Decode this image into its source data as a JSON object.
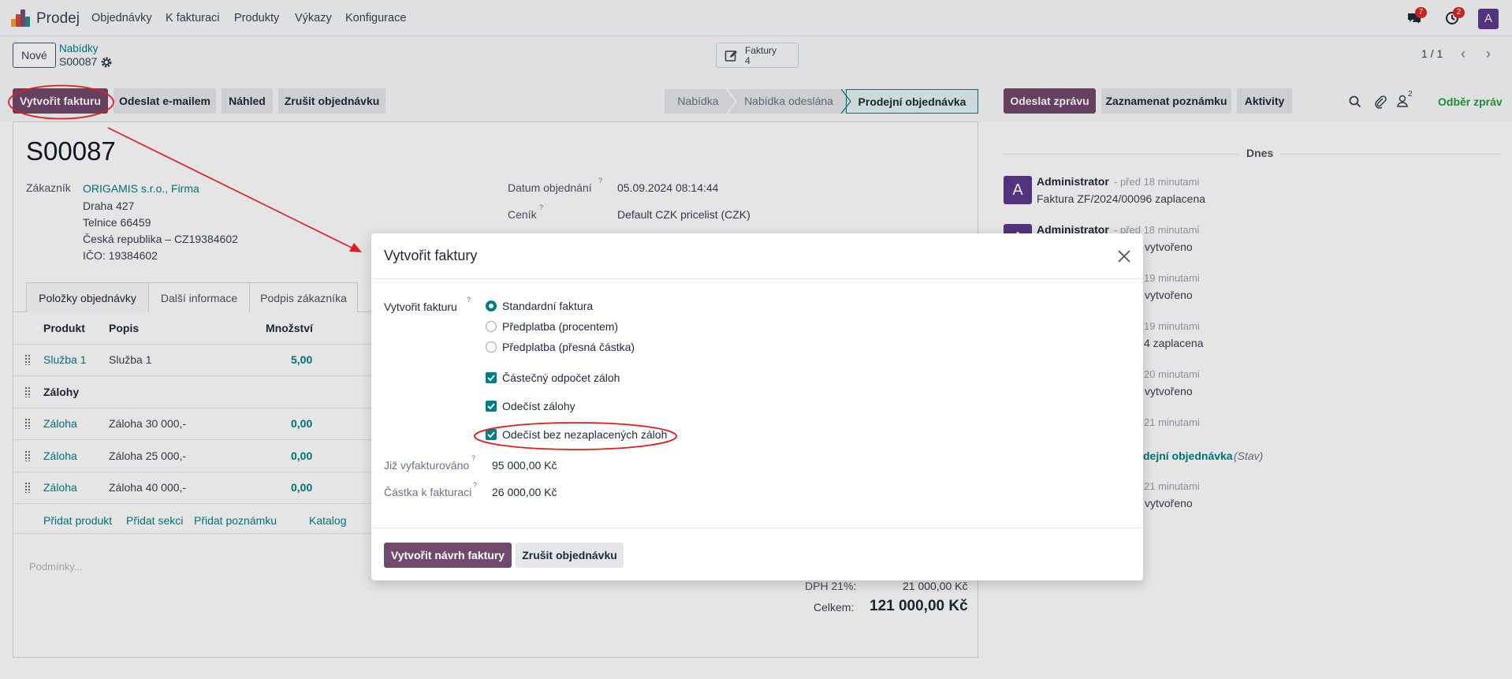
{
  "app": {
    "name": "Prodej",
    "menu": [
      "Objednávky",
      "K fakturaci",
      "Produkty",
      "Výkazy",
      "Konfigurace"
    ],
    "messages_badge": "7",
    "activities_badge": "2",
    "user_initial": "A",
    "brand_color": "#71496b",
    "accent_color": "#017e84"
  },
  "control": {
    "new_button": "Nové",
    "breadcrumb_parent": "Nabídky",
    "breadcrumb_current": "S00087",
    "stat_label": "Faktury",
    "stat_value": "4",
    "pager": "1 / 1"
  },
  "actions": {
    "create_invoice": "Vytvořit fakturu",
    "send_email": "Odeslat e-mailem",
    "preview": "Náhled",
    "cancel_order": "Zrušit objednávku"
  },
  "status_stages": [
    "Nabídka",
    "Nabídka odeslána",
    "Prodejní objednávka"
  ],
  "form": {
    "order_name": "S00087",
    "customer_label": "Zákazník",
    "customer_name": "ORIGAMIS s.r.o., Firma",
    "address_lines": [
      "Draha 427",
      "Telnice 66459",
      "Česká republika – CZ19384602",
      "IČO: 19384602"
    ],
    "order_date_label": "Datum objednání",
    "order_date": "05.09.2024 08:14:44",
    "pricelist_label": "Ceník",
    "pricelist": "Default CZK pricelist (CZK)",
    "tabs": [
      "Položky objednávky",
      "Další informace",
      "Podpis zákazníka"
    ],
    "columns": [
      "Produkt",
      "Popis",
      "Množství"
    ],
    "lines": [
      {
        "product": "Služba 1",
        "description": "Služba 1",
        "qty": "5,00"
      },
      {
        "section": "Zálohy"
      },
      {
        "product": "Záloha",
        "description": "Záloha 30 000,-",
        "qty": "0,00"
      },
      {
        "product": "Záloha",
        "description": "Záloha 25 000,-",
        "qty": "0,00"
      },
      {
        "product": "Záloha",
        "description": "Záloha 40 000,-",
        "qty": "0,00"
      }
    ],
    "add_links": [
      "Přidat produkt",
      "Přidat sekci",
      "Přidat poznámku",
      "Katalog"
    ],
    "terms_placeholder": "Podmínky...",
    "tax_label": "DPH 21%:",
    "tax_value": "21 000,00 Kč",
    "total_label": "Celkem:",
    "total_value": "121 000,00 Kč"
  },
  "chatter": {
    "send_message": "Odeslat zprávu",
    "log_note": "Zaznamenat poznámku",
    "activities": "Aktivity",
    "followers_count": "2",
    "follow": "Odběr zpráv",
    "date_separator": "Dnes",
    "messages": [
      {
        "author": "Administrator",
        "time": "- před 18 minutami",
        "body": "Faktura ZF/2024/00096 zaplacena"
      },
      {
        "author": "Administrator",
        "time": "- před 18 minutami",
        "body": "vytvořeno"
      }
    ],
    "hidden_fragments": [
      {
        "time": "19 minutami",
        "body": "vytvořeno"
      },
      {
        "time": "19 minutami",
        "body": "4 zaplacena"
      },
      {
        "time": "20 minutami",
        "body": "vytvořeno"
      },
      {
        "time": "21 minutami",
        "body": ""
      },
      {
        "time": "",
        "body": "dejní objednávka",
        "extra": "(Stav)"
      },
      {
        "time": "21 minutami",
        "body": "vytvořeno"
      }
    ]
  },
  "modal": {
    "title": "Vytvořit faktury",
    "field_label": "Vytvořit fakturu",
    "radio_options": [
      {
        "label": "Standardní faktura",
        "selected": true
      },
      {
        "label": "Předplatba (procentem)",
        "selected": false
      },
      {
        "label": "Předplatba (přesná částka)",
        "selected": false
      }
    ],
    "checkboxes": [
      {
        "label": "Částečný odpočet záloh",
        "checked": true
      },
      {
        "label": "Odečíst zálohy",
        "checked": true
      },
      {
        "label": "Odečíst bez nezaplacených záloh",
        "checked": true
      }
    ],
    "already_invoiced_label": "Již vyfakturováno",
    "already_invoiced_value": "95 000,00 Kč",
    "to_invoice_label": "Částka k fakturaci",
    "to_invoice_value": "26 000,00 Kč",
    "primary_button": "Vytvořit návrh faktury",
    "secondary_button": "Zrušit objednávku"
  },
  "annotation_color": "#e11d1d"
}
